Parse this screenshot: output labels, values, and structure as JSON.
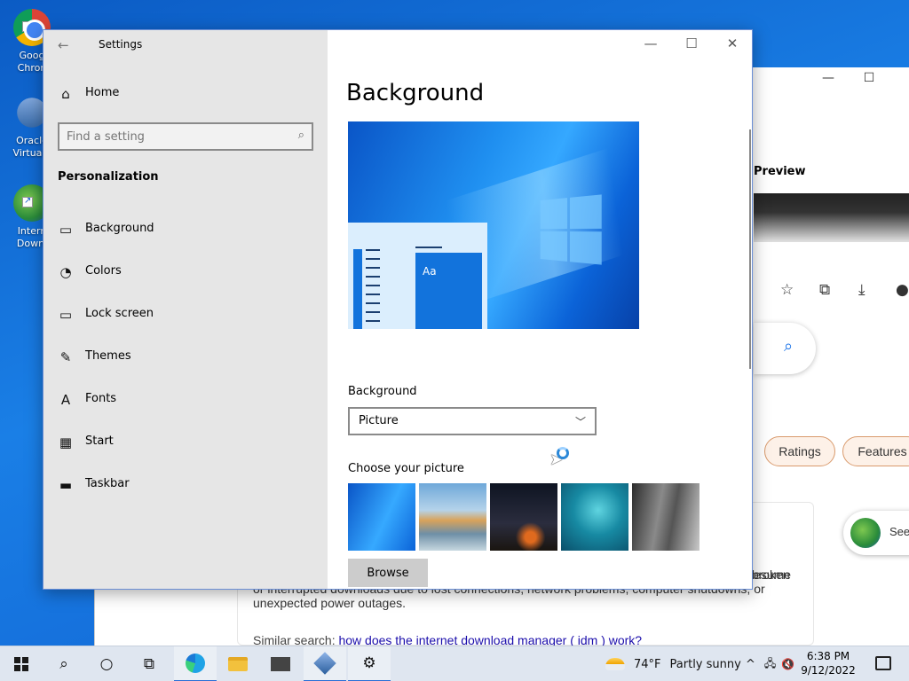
{
  "desktop": {
    "icons": [
      {
        "label_line1": "Goog",
        "label_line2": "Chron",
        "icon": "chrome-icon"
      },
      {
        "label_line1": "Oracle",
        "label_line2": "Virtualb",
        "icon": "virtualbox-icon"
      },
      {
        "label_line1": "Intern",
        "label_line2": "Downl",
        "icon": "idm-icon"
      }
    ]
  },
  "background_window": {
    "preview_label": "Preview",
    "chips": [
      "Ratings",
      "Features"
    ],
    "see_card_text": "See",
    "paragraph_right": "esume",
    "paragraph": "and schedule downloads. Comprehensive error recovery and resume capability will restart broken or interrupted downloads due to lost connections, network problems, computer shutdowns, or unexpected power outages.",
    "similar_prefix": "Similar search: ",
    "similar_link": "how does the internet download manager ( idm ) work?",
    "controls": {
      "minimize": "—",
      "maximize": "☐"
    }
  },
  "settings": {
    "window_title": "Settings",
    "back_glyph": "←",
    "home_label": "Home",
    "search": {
      "placeholder": "Find a setting",
      "value": ""
    },
    "section": "Personalization",
    "nav": [
      {
        "label": "Background",
        "icon": "picture-icon",
        "glyph": "▭"
      },
      {
        "label": "Colors",
        "icon": "palette-icon",
        "glyph": "◔"
      },
      {
        "label": "Lock screen",
        "icon": "lock-screen-icon",
        "glyph": "▭"
      },
      {
        "label": "Themes",
        "icon": "themes-icon",
        "glyph": "✎"
      },
      {
        "label": "Fonts",
        "icon": "fonts-icon",
        "glyph": "A"
      },
      {
        "label": "Start",
        "icon": "start-menu-icon",
        "glyph": "▦"
      },
      {
        "label": "Taskbar",
        "icon": "taskbar-icon",
        "glyph": "▬"
      }
    ],
    "controls": {
      "minimize": "—",
      "maximize": "☐",
      "close": "✕"
    },
    "page_title": "Background",
    "preview_tile_text": "Aa",
    "background_label": "Background",
    "background_select": {
      "value": "Picture",
      "options": [
        "Picture"
      ]
    },
    "choose_label": "Choose your picture",
    "browse_label": "Browse"
  },
  "taskbar": {
    "weather": {
      "temp": "74°F",
      "condition": "Partly sunny"
    },
    "clock": {
      "time": "6:38 PM",
      "date": "9/12/2022"
    },
    "tray_glyphs": {
      "chevron": "^",
      "network": "🖧",
      "volume": "🔇"
    }
  },
  "colors": {
    "accent": "#0078d7",
    "sidebar_bg": "#e6e6e6",
    "taskbar_bg": "#dfe6f0"
  }
}
